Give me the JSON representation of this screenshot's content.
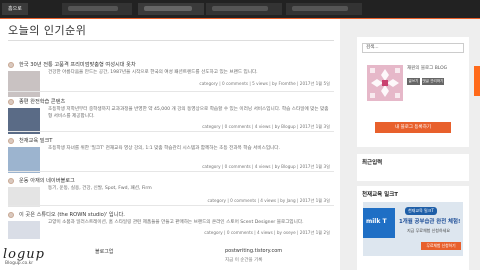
{
  "topnav": {
    "home": "홈으로",
    "tabs": []
  },
  "page": {
    "title": "오늘의 인기순위"
  },
  "posts": [
    {
      "rank": "1",
      "title": "한국 30년 전통 고품격 프리미엄맞춤형 여성시대 옷차",
      "excerpt": "건강한 아름다움을 만드는 공간, 1987년을 시작으로 한국의 여성 패션트렌드를 선도하고 있는 브랜드 입니다.",
      "meta": "category | 0 comments | 5 views | by Fromthe | 2017년 1월 5일"
    },
    {
      "rank": "2",
      "title": "종편 완전학습 콘텐츠",
      "excerpt": "초등학생 저학년부터 중학생까지 교과과정을 반영한 약 45,000 개 강의 동영상으로 학습할 수 있는 이러닝 서비스입니다. 학습 스타일에 맞는 맞춤형 서비스를 제공합니다.",
      "meta": "category | 0 comments | 4 views | by Blogup | 2017년 1월 3일"
    },
    {
      "rank": "3",
      "title": "천재교육 밀크T",
      "excerpt": "초등학생 자녀를 위한 '밀크T' 천재교육 영상 강의, 1:1 맞춤 학습관리 시스템과 함께하는 초등 전과목 학습 서비스입니다.",
      "meta": "category | 0 comments | 4 views | by Blogup | 2017년 1월 3일"
    },
    {
      "rank": "4",
      "title": "운동 아재의 네이버블로그",
      "excerpt": "동기, 운동, 실용, 건강, 신발, Spot, Fwd, 패션, Firm",
      "meta": "category | 0 comments | 4 views | by Jang | 2017년 1월 3일"
    },
    {
      "rank": "5",
      "title": "이 곳은 스튜디오 (the ROWN studio)' 입니다.",
      "excerpt": "고양이 소품과 일러스트레이션, 홈 스타일링 관련 제품들을 만들고 판매하는 브랜드의 온라인 스토어 Scent Designer 블로그입니다.",
      "meta": "category | 0 comments | 4 views | by oseye | 2017년 1월 2일"
    }
  ],
  "footer": {
    "logo": "logup",
    "logo_sub": "Blogup.co.kr",
    "col2": "블로그업",
    "col2_sub": "",
    "col3": "postwriting.tistory.com",
    "col3_sub": "지금 이 순간을 기록"
  },
  "sidebar": {
    "search_placeholder": "검색...",
    "blog_name": "재원의 블로그 BLOG",
    "btn_post": "글쓰기",
    "btn_reply": "댓글 관리하기",
    "btn_add": "내 블로그 등록하기",
    "recent_title": "최근입력",
    "ad_title": "천재교육 밀크T",
    "ad": {
      "badge": "천재교육 밀크T",
      "headline": "1개월 공부습관 완전 체험!",
      "sub": "지금 무료체험 신청하세요",
      "brand": "milk T",
      "button": "무료체험 신청하기"
    }
  },
  "colors": {
    "accent": "#e8602c",
    "nav": "#222222"
  }
}
